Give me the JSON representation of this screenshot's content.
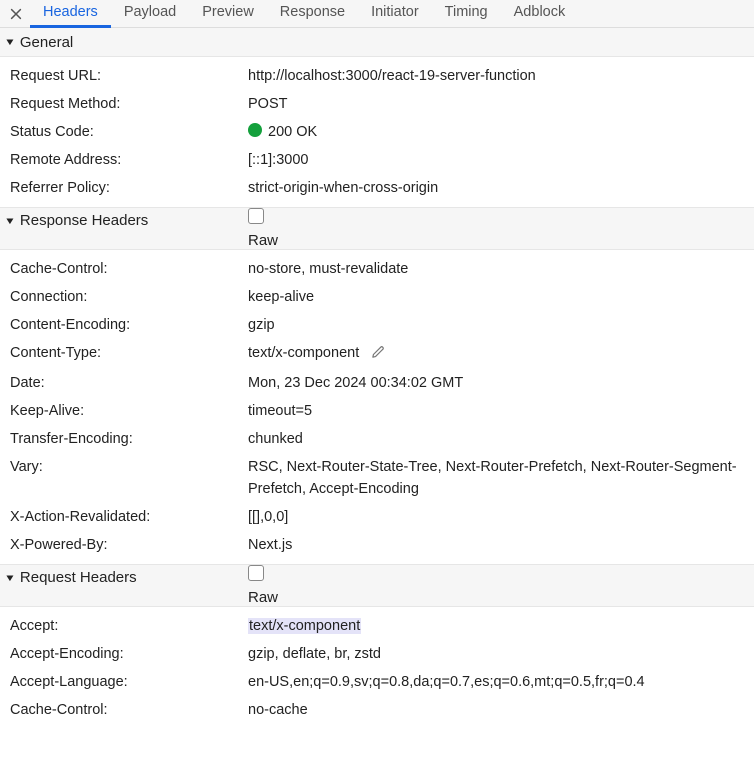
{
  "tabs": [
    "Headers",
    "Payload",
    "Preview",
    "Response",
    "Initiator",
    "Timing",
    "Adblock"
  ],
  "active_tab": 0,
  "sections": {
    "general": {
      "title": "General",
      "rows": [
        {
          "label": "Request URL:",
          "value": "http://localhost:3000/react-19-server-function"
        },
        {
          "label": "Request Method:",
          "value": "POST"
        },
        {
          "label": "Status Code:",
          "value": "200 OK",
          "status": true
        },
        {
          "label": "Remote Address:",
          "value": "[::1]:3000"
        },
        {
          "label": "Referrer Policy:",
          "value": "strict-origin-when-cross-origin"
        }
      ]
    },
    "response_headers": {
      "title": "Response Headers",
      "raw_label": "Raw",
      "rows": [
        {
          "label": "Cache-Control:",
          "value": "no-store, must-revalidate"
        },
        {
          "label": "Connection:",
          "value": "keep-alive"
        },
        {
          "label": "Content-Encoding:",
          "value": "gzip"
        },
        {
          "label": "Content-Type:",
          "value": "text/x-component",
          "editable": true
        },
        {
          "label": "Date:",
          "value": "Mon, 23 Dec 2024 00:34:02 GMT"
        },
        {
          "label": "Keep-Alive:",
          "value": "timeout=5"
        },
        {
          "label": "Transfer-Encoding:",
          "value": "chunked"
        },
        {
          "label": "Vary:",
          "value": "RSC, Next-Router-State-Tree, Next-Router-Prefetch, Next-Router-Segment-Prefetch, Accept-Encoding"
        },
        {
          "label": "X-Action-Revalidated:",
          "value": "[[],0,0]"
        },
        {
          "label": "X-Powered-By:",
          "value": "Next.js"
        }
      ]
    },
    "request_headers": {
      "title": "Request Headers",
      "raw_label": "Raw",
      "rows": [
        {
          "label": "Accept:",
          "value": "text/x-component",
          "highlight": true
        },
        {
          "label": "Accept-Encoding:",
          "value": "gzip, deflate, br, zstd"
        },
        {
          "label": "Accept-Language:",
          "value": "en-US,en;q=0.9,sv;q=0.8,da;q=0.7,es;q=0.6,mt;q=0.5,fr;q=0.4"
        },
        {
          "label": "Cache-Control:",
          "value": "no-cache"
        }
      ]
    }
  }
}
